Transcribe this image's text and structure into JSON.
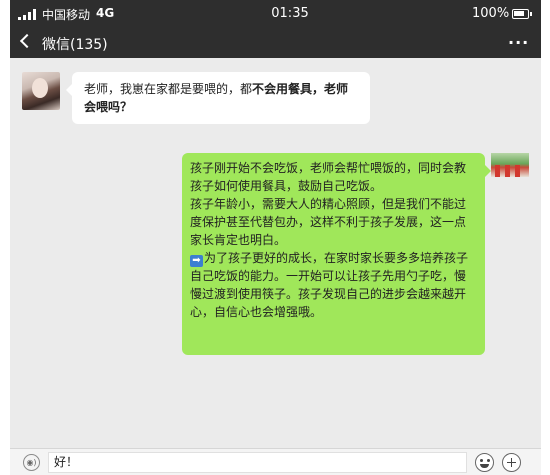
{
  "status_bar": {
    "carrier": "中国移动",
    "network": "4G",
    "time": "01:35",
    "battery": "100%"
  },
  "nav": {
    "title": "微信(135)",
    "more": "···"
  },
  "messages": {
    "incoming": {
      "text_plain": "老师，我崽在家都是要喂的，都",
      "text_bold": "不会用餐具，老师会喂吗？"
    },
    "outgoing": {
      "para1": "孩子刚开始不会吃饭，老师会帮忙喂饭的，同时会教孩子如何使用餐具，鼓励自己吃饭。",
      "para2": "孩子年龄小，需要大人的精心照顾，但是我们不能过度保护甚至代替包办，这样不利于孩子发展，这一点家长肯定也明白。",
      "arrow": "➡",
      "para3": "为了孩子更好的成长，在家时家长要多多培养孩子自己吃饭的能力。一开始可以让孩子先用勺子吃，慢慢过渡到使用筷子。孩子发现自己的进步会越来越开心，自信心也会增强哦。"
    }
  },
  "input_bar": {
    "voice": "◉)",
    "value": "好！"
  },
  "colors": {
    "header_bg": "#2e2e2e",
    "chat_bg": "#ebebeb",
    "outgoing_bubble": "#a0e75a",
    "incoming_bubble": "#ffffff"
  },
  "icons": [
    "signal-icon",
    "battery-icon",
    "back-icon",
    "more-icon",
    "voice-icon",
    "emoji-icon",
    "plus-icon",
    "arrow-icon"
  ]
}
